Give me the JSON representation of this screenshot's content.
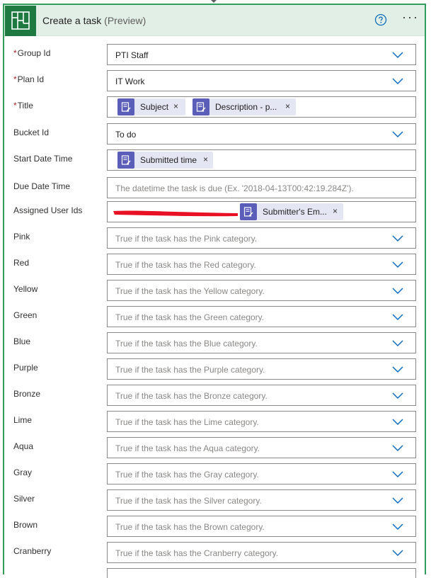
{
  "header": {
    "title": "Create a task",
    "title_suffix": "(Preview)",
    "help_icon": "help-circle-icon",
    "more_icon": "ellipsis-icon",
    "more_label": "···",
    "accent_color": "#1f7a42",
    "header_bg": "#e1efe6"
  },
  "fields": {
    "group_id": {
      "label": "Group Id",
      "required": "*",
      "value": "PTI Staff"
    },
    "plan_id": {
      "label": "Plan Id",
      "required": "*",
      "value": "IT Work"
    },
    "title": {
      "label": "Title",
      "required": "*",
      "tokens": [
        {
          "label": "Subject",
          "remove": "×"
        },
        {
          "label": "Description - p...",
          "remove": "×"
        }
      ]
    },
    "bucket_id": {
      "label": "Bucket Id",
      "value": "To do"
    },
    "start_date_time": {
      "label": "Start Date Time",
      "tokens": [
        {
          "label": "Submitted time",
          "remove": "×"
        }
      ]
    },
    "due_date_time": {
      "label": "Due Date Time",
      "placeholder": "The datetime the task is due (Ex. '2018-04-13T00:42:19.284Z')."
    },
    "assigned_user_ids": {
      "label": "Assigned User Ids",
      "tokens": [
        {
          "label": "Submitter's Em...",
          "remove": "×"
        }
      ]
    }
  },
  "categories": [
    {
      "label": "Pink",
      "placeholder": "True if the task has the Pink category."
    },
    {
      "label": "Red",
      "placeholder": "True if the task has the Red category."
    },
    {
      "label": "Yellow",
      "placeholder": "True if the task has the Yellow category."
    },
    {
      "label": "Green",
      "placeholder": "True if the task has the Green category."
    },
    {
      "label": "Blue",
      "placeholder": "True if the task has the Blue category."
    },
    {
      "label": "Purple",
      "placeholder": "True if the task has the Purple category."
    },
    {
      "label": "Bronze",
      "placeholder": "True if the task has the Bronze category."
    },
    {
      "label": "Lime",
      "placeholder": "True if the task has the Lime category."
    },
    {
      "label": "Aqua",
      "placeholder": "True if the task has the Aqua category."
    },
    {
      "label": "Gray",
      "placeholder": "True if the task has the Gray category."
    },
    {
      "label": "Silver",
      "placeholder": "True if the task has the Silver category."
    },
    {
      "label": "Brown",
      "placeholder": "True if the task has the Brown category."
    },
    {
      "label": "Cranberry",
      "placeholder": "True if the task has the Cranberry category."
    }
  ],
  "colors": {
    "required": "#a4262c",
    "token_bg": "#e5e6f4",
    "token_icon": "#5a5eb9",
    "chevron": "#0f6cbd",
    "redaction": "#e81123"
  }
}
